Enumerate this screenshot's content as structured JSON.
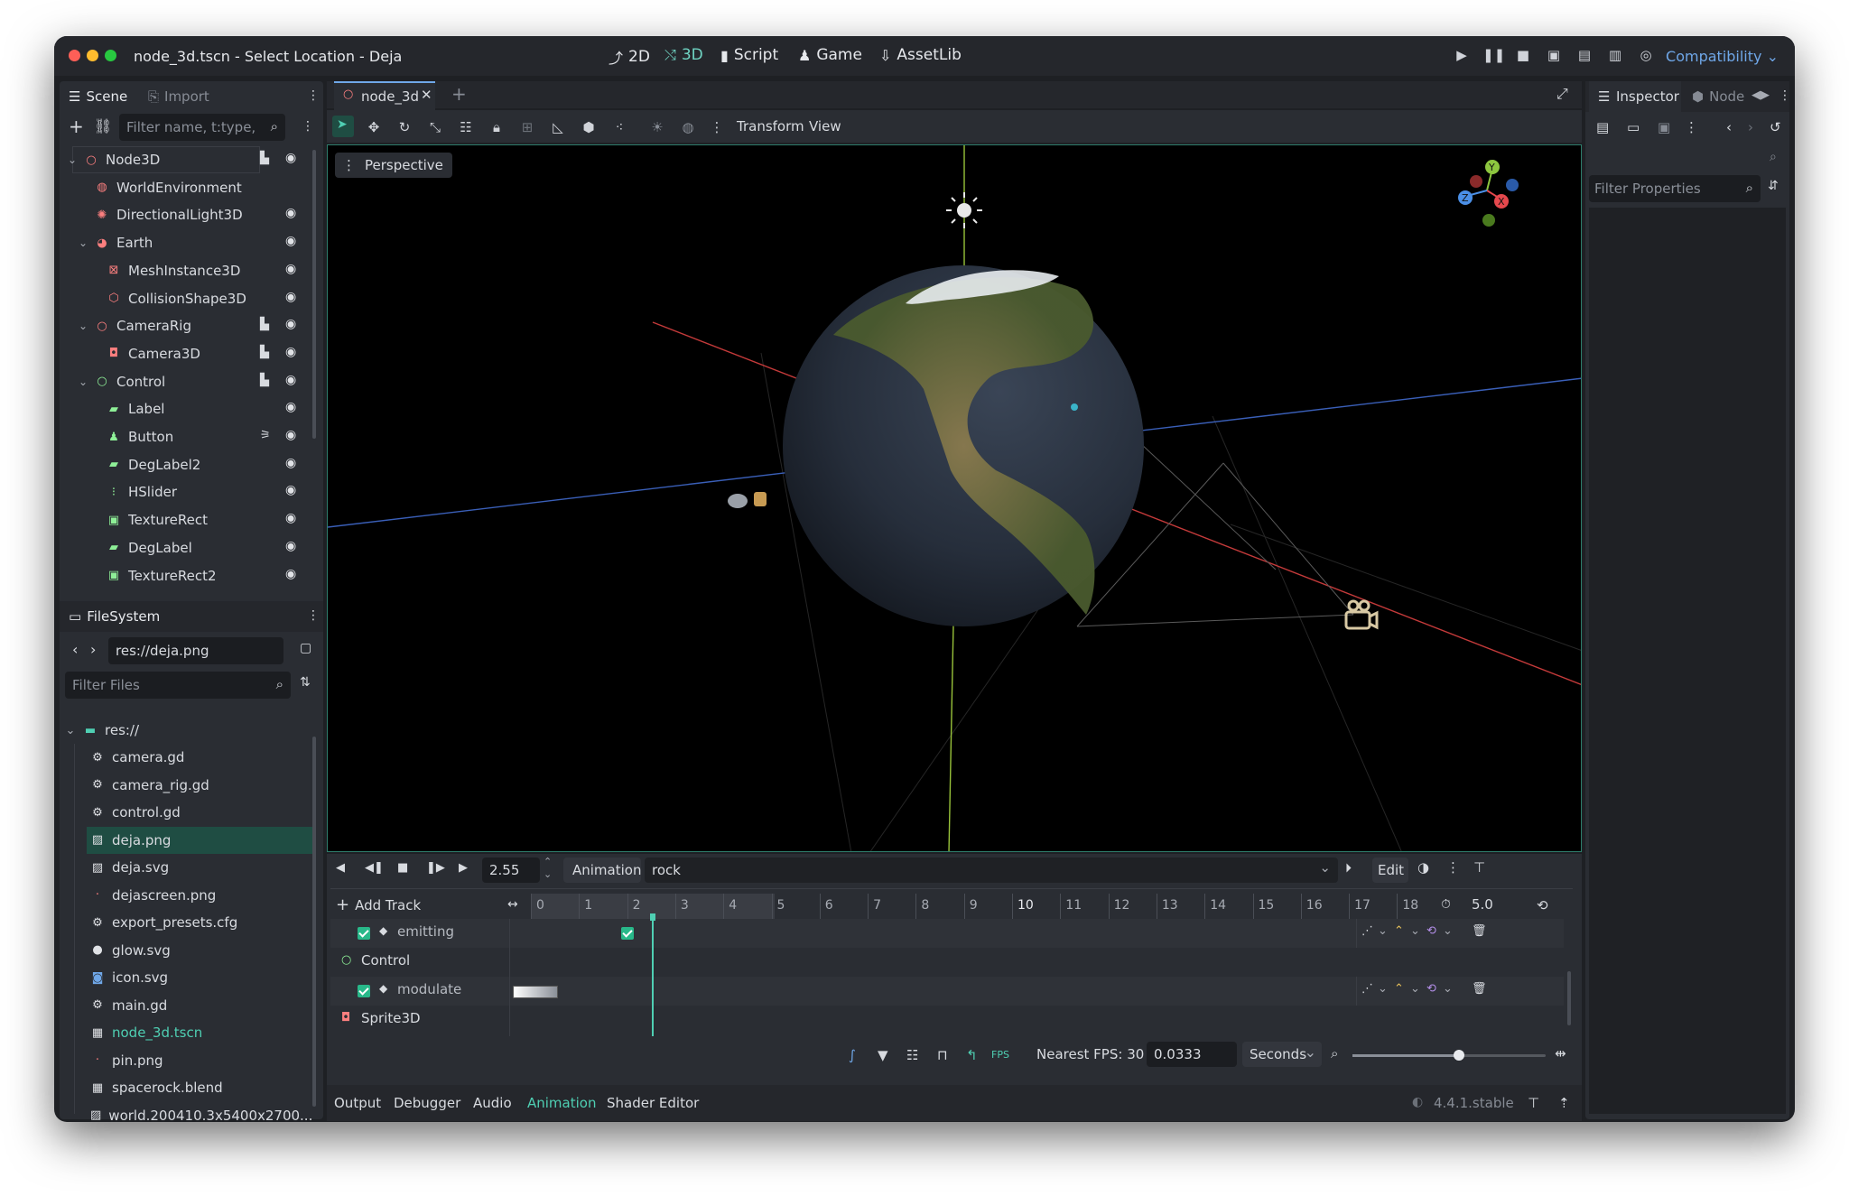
{
  "window": {
    "title": "node_3d.tscn - Select Location - Deja",
    "workspaces": [
      {
        "label": "2D",
        "icon": "2d-icon",
        "active": false
      },
      {
        "label": "3D",
        "icon": "3d-icon",
        "active": true
      },
      {
        "label": "Script",
        "icon": "script-icon",
        "active": false
      },
      {
        "label": "Game",
        "icon": "game-icon",
        "active": false
      },
      {
        "label": "AssetLib",
        "icon": "assetlib-icon",
        "active": false
      }
    ],
    "renderer": "Compatibility"
  },
  "scene_dock": {
    "tabs": [
      "Scene",
      "Import"
    ],
    "filter_placeholder": "Filter name, t:type,",
    "nodes": [
      {
        "label": "Node3D",
        "icon": "node3d-icon",
        "color": "#fc7f7f",
        "depth": 0,
        "expand": true,
        "script": true,
        "visible": true
      },
      {
        "label": "WorldEnvironment",
        "icon": "world-environment-icon",
        "color": "#fc7f7f",
        "depth": 1,
        "expand": false,
        "script": false,
        "visible": false
      },
      {
        "label": "DirectionalLight3D",
        "icon": "directional-light-icon",
        "color": "#fc7f7f",
        "depth": 1,
        "expand": false,
        "script": false,
        "visible": true
      },
      {
        "label": "Earth",
        "icon": "earth-node-icon",
        "color": "#fc7f7f",
        "depth": 1,
        "expand": true,
        "script": false,
        "visible": true
      },
      {
        "label": "MeshInstance3D",
        "icon": "mesh-instance-icon",
        "color": "#fc7f7f",
        "depth": 2,
        "expand": false,
        "script": false,
        "visible": true
      },
      {
        "label": "CollisionShape3D",
        "icon": "collision-shape-icon",
        "color": "#fc7f7f",
        "depth": 2,
        "expand": false,
        "script": false,
        "visible": true
      },
      {
        "label": "CameraRig",
        "icon": "camera-rig-icon",
        "color": "#fc7f7f",
        "depth": 1,
        "expand": true,
        "script": true,
        "visible": true
      },
      {
        "label": "Camera3D",
        "icon": "camera3d-icon",
        "color": "#fc7f7f",
        "depth": 2,
        "expand": false,
        "script": true,
        "visible": true
      },
      {
        "label": "Control",
        "icon": "control-icon",
        "color": "#8eef97",
        "depth": 1,
        "expand": true,
        "script": true,
        "visible": true
      },
      {
        "label": "Label",
        "icon": "label-icon",
        "color": "#8eef97",
        "depth": 2,
        "expand": false,
        "script": false,
        "visible": true
      },
      {
        "label": "Button",
        "icon": "button-icon",
        "color": "#8eef97",
        "depth": 2,
        "expand": false,
        "script": false,
        "visible": true,
        "signal": true
      },
      {
        "label": "DegLabel2",
        "icon": "label-icon",
        "color": "#8eef97",
        "depth": 2,
        "expand": false,
        "script": false,
        "visible": true
      },
      {
        "label": "HSlider",
        "icon": "hslider-icon",
        "color": "#8eef97",
        "depth": 2,
        "expand": false,
        "script": false,
        "visible": true
      },
      {
        "label": "TextureRect",
        "icon": "texture-rect-icon",
        "color": "#8eef97",
        "depth": 2,
        "expand": false,
        "script": false,
        "visible": true
      },
      {
        "label": "DegLabel",
        "icon": "label-icon",
        "color": "#8eef97",
        "depth": 2,
        "expand": false,
        "script": false,
        "visible": true
      },
      {
        "label": "TextureRect2",
        "icon": "texture-rect-icon",
        "color": "#8eef97",
        "depth": 2,
        "expand": false,
        "script": false,
        "visible": true
      }
    ]
  },
  "filesystem_dock": {
    "tab": "FileSystem",
    "path": "res://deja.png",
    "filter_placeholder": "Filter Files",
    "root": "res://",
    "files": [
      {
        "label": "camera.gd",
        "icon": "gear-icon",
        "selected": false,
        "highlight": false
      },
      {
        "label": "camera_rig.gd",
        "icon": "gear-icon",
        "selected": false,
        "highlight": false
      },
      {
        "label": "control.gd",
        "icon": "gear-icon",
        "selected": false,
        "highlight": false
      },
      {
        "label": "deja.png",
        "icon": "image-icon",
        "selected": true,
        "highlight": false
      },
      {
        "label": "deja.svg",
        "icon": "image-icon",
        "selected": false,
        "highlight": false
      },
      {
        "label": "dejascreen.png",
        "icon": "dot-icon",
        "selected": false,
        "highlight": false
      },
      {
        "label": "export_presets.cfg",
        "icon": "gear-icon",
        "selected": false,
        "highlight": false
      },
      {
        "label": "glow.svg",
        "icon": "circle-icon",
        "selected": false,
        "highlight": false
      },
      {
        "label": "icon.svg",
        "icon": "godot-icon",
        "selected": false,
        "highlight": false
      },
      {
        "label": "main.gd",
        "icon": "gear-icon",
        "selected": false,
        "highlight": false
      },
      {
        "label": "node_3d.tscn",
        "icon": "scene-icon",
        "selected": false,
        "highlight": true
      },
      {
        "label": "pin.png",
        "icon": "dot-icon",
        "selected": false,
        "highlight": false
      },
      {
        "label": "spacerock.blend",
        "icon": "scene-icon",
        "selected": false,
        "highlight": false
      },
      {
        "label": "world.200410.3x5400x2700...",
        "icon": "image-icon",
        "selected": false,
        "highlight": false
      }
    ]
  },
  "editor": {
    "tab": "node_3d",
    "toolbar": {
      "transform": "Transform",
      "view": "View"
    },
    "viewport_label": "Perspective"
  },
  "inspector": {
    "tabs": [
      "Inspector",
      "Node"
    ],
    "filter_placeholder": "Filter Properties"
  },
  "animation": {
    "time": "2.55",
    "label": "Animation",
    "current": "rock",
    "edit": "Edit",
    "add_track": "Add Track",
    "length": "5.0",
    "ticks": [
      "0",
      "1",
      "2",
      "3",
      "4",
      "5",
      "6",
      "7",
      "8",
      "9",
      "10",
      "11",
      "12",
      "13",
      "14",
      "15",
      "16",
      "17",
      "18"
    ],
    "tracks": [
      {
        "label": "emitting",
        "type": "property",
        "checked": true
      },
      {
        "label": "Control",
        "type": "node"
      },
      {
        "label": "modulate",
        "type": "property",
        "checked": true
      },
      {
        "label": "Sprite3D",
        "type": "node"
      }
    ],
    "snap_label": "Nearest FPS: 30",
    "step": "0.0333",
    "unit": "Seconds",
    "zoom": 0.55
  },
  "bottom_panel": {
    "tabs": [
      "Output",
      "Debugger",
      "Audio",
      "Animation",
      "Shader Editor"
    ],
    "active": "Animation",
    "version": "4.4.1.stable"
  }
}
